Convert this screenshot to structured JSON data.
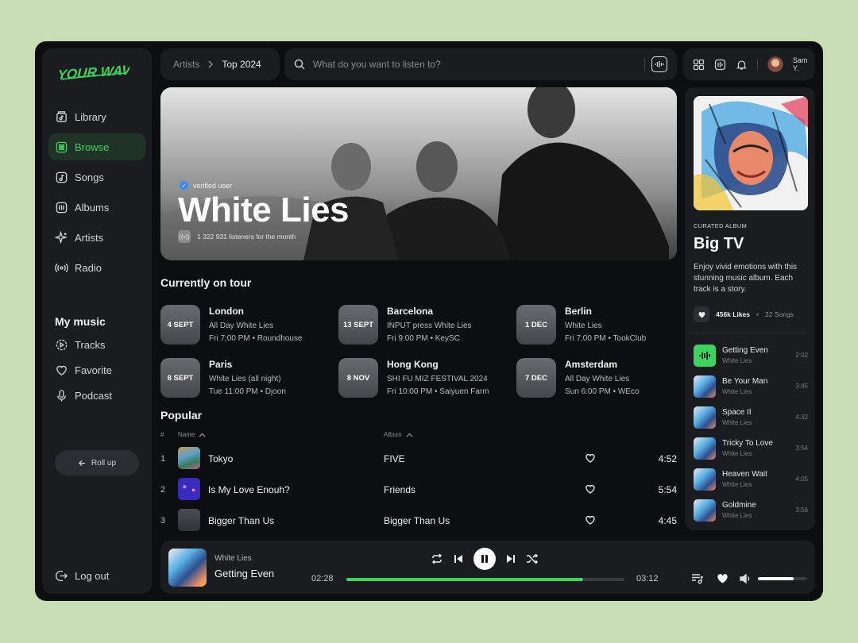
{
  "app": {
    "logo_text": "YOUR WAVE"
  },
  "sidebar": {
    "nav": [
      {
        "label": "Library",
        "icon": "library-icon"
      },
      {
        "label": "Browse",
        "icon": "browse-icon",
        "active": true
      },
      {
        "label": "Songs",
        "icon": "songs-icon"
      },
      {
        "label": "Albums",
        "icon": "albums-icon"
      },
      {
        "label": "Artists",
        "icon": "sparkle-icon"
      },
      {
        "label": "Radio",
        "icon": "radio-icon"
      }
    ],
    "my_music_title": "My music",
    "my_music": [
      {
        "label": "Tracks",
        "icon": "play-circle-icon"
      },
      {
        "label": "Favorite",
        "icon": "heart-icon"
      },
      {
        "label": "Podcast",
        "icon": "microphone-icon"
      }
    ],
    "roll_up_label": "Roll up",
    "logout_label": "Log out"
  },
  "breadcrumb": {
    "parent": "Artists",
    "current": "Top 2024"
  },
  "search": {
    "placeholder": "What do you want to listen to?",
    "value": ""
  },
  "user": {
    "name": "Sam Y."
  },
  "hero": {
    "verified_label": "verified user",
    "artist": "White Lies",
    "listeners": "1 322 931 listeners for the month"
  },
  "tour": {
    "title": "Currently on tour",
    "events": [
      {
        "date": "4 SEPT",
        "city": "London",
        "event": "All Day White Lies",
        "when": "Fri 7:00 PM • Roundhouse"
      },
      {
        "date": "13 SEPT",
        "city": "Barcelona",
        "event": "INPUT press White Lies",
        "when": "Fri 9:00 PM • KeySC"
      },
      {
        "date": "1 DEC",
        "city": "Berlin",
        "event": "White Lies",
        "when": "Fri 7:00 PM • TookClub"
      },
      {
        "date": "8 SEPT",
        "city": "Paris",
        "event": "White Lies (all night)",
        "when": "Tue 11:00 PM • Djoon"
      },
      {
        "date": "8 NOV",
        "city": "Hong Kong",
        "event": "SHI FU MIZ FESTIVAL 2024",
        "when": "Fri 10:00 PM • Saiyuen Farm"
      },
      {
        "date": "7 DEC",
        "city": "Amsterdam",
        "event": "All Day White Lies",
        "when": "Sun 6:00 PM • WEco"
      }
    ]
  },
  "popular": {
    "title": "Popular",
    "columns": {
      "num": "#",
      "name": "Name",
      "album": "Album"
    },
    "tracks": [
      {
        "num": "1",
        "name": "Tokyo",
        "album": "FIVE",
        "duration": "4:52"
      },
      {
        "num": "2",
        "name": "Is My Love Enouh?",
        "album": "Friends",
        "duration": "5:54"
      },
      {
        "num": "3",
        "name": "Bigger Than Us",
        "album": "Bigger Than Us",
        "duration": "4:45"
      }
    ]
  },
  "album_panel": {
    "label": "CURATED ALBUM",
    "title": "Big TV",
    "description": "Enjoy vivid emotions with this stunning music album. Each track is a story.",
    "likes": "456k Likes",
    "songs": "22 Songs",
    "tracks": [
      {
        "title": "Getting Even",
        "artist": "White Lies",
        "duration": "2:02",
        "playing": true
      },
      {
        "title": "Be Your Man",
        "artist": "White Lies",
        "duration": "3:45"
      },
      {
        "title": "Space II",
        "artist": "White Lies",
        "duration": "4:32"
      },
      {
        "title": "Tricky To Love",
        "artist": "White Lies",
        "duration": "3:54"
      },
      {
        "title": "Heaven Wait",
        "artist": "White Lies",
        "duration": "4:05"
      },
      {
        "title": "Goldmine",
        "artist": "White Lies",
        "duration": "3:56"
      }
    ]
  },
  "player": {
    "artist": "White Lies",
    "title": "Getting Even",
    "elapsed": "02:28",
    "total": "03:12",
    "progress": 0.85,
    "volume": 0.72
  },
  "colors": {
    "accent": "#3ed25e",
    "background": "#0d0e11",
    "panel": "#1b1c20",
    "page": "#c7ddb6"
  }
}
